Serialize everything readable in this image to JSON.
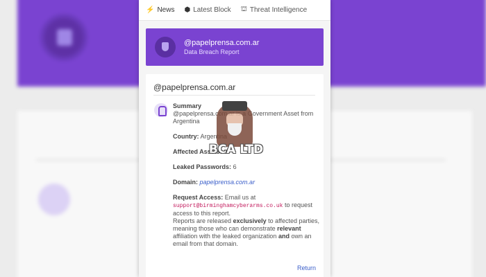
{
  "tabs": [
    {
      "label": "News",
      "icon": "bolt-icon"
    },
    {
      "label": "Latest Block",
      "icon": "cube-icon"
    },
    {
      "label": "Threat Intelligence",
      "icon": "shield-icon"
    }
  ],
  "header": {
    "title": "@papelprensa.com.ar",
    "subtitle": "Data Breach Report",
    "color": "#7a43d1"
  },
  "report": {
    "title": "@papelprensa.com.ar",
    "summary_label": "Summary",
    "summary_text": "@papelprensa.com.ar is a Government Asset from Argentina",
    "country_label": "Country:",
    "country_value": "Argentina",
    "assets_label": "Affected Assets:",
    "assets_value": "0",
    "passwords_label": "Leaked Passwords:",
    "passwords_value": "6",
    "domain_label": "Domain:",
    "domain_value": "papelprensa.com.ar",
    "request_label": "Request Access:",
    "request_text_1": "Email us at",
    "request_email": "support@birminghamcyberarms.co.uk",
    "request_text_2": "to request access to this report.",
    "release_1": "Reports are released",
    "release_exclusively": "exclusively",
    "release_2": "to affected parties, meaning those who can demonstrate",
    "release_relevant": "relevant",
    "release_3": "affiliation with the leaked organization",
    "release_and": "and",
    "release_4": "own an email from that domain.",
    "return_label": "Return"
  },
  "watermark": {
    "text": "BCA LTD"
  }
}
